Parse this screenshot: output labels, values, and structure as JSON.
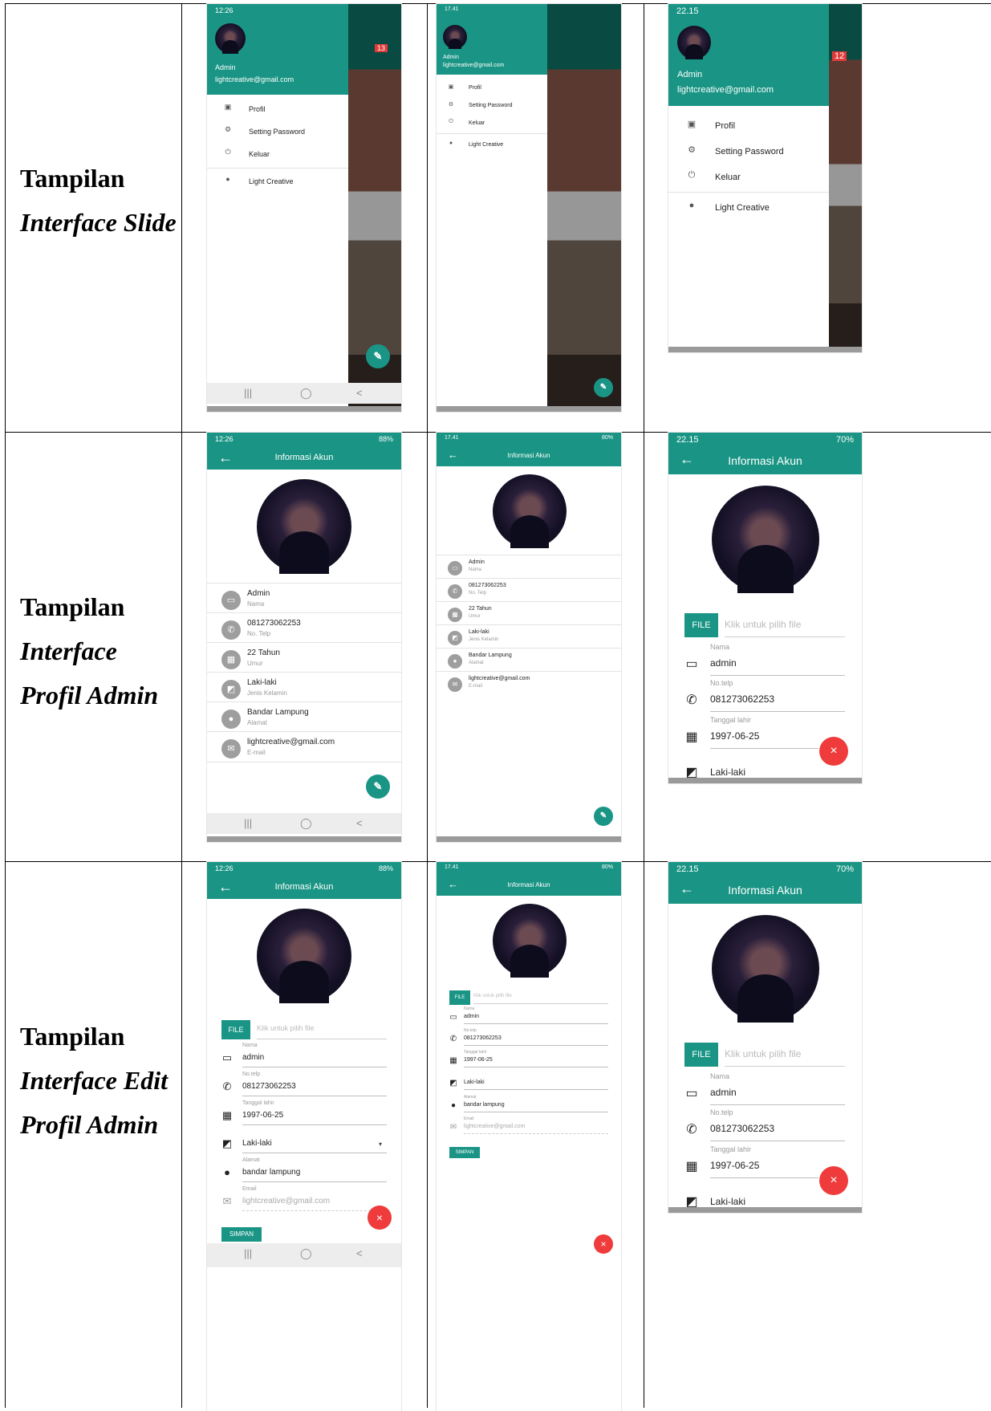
{
  "rows": [
    {
      "label": {
        "line1": "Tampilan",
        "line2": "Interface  Slide",
        "line3": ""
      }
    },
    {
      "label": {
        "line1": "Tampilan",
        "line2": "Interface",
        "line3": "Profil Admin"
      }
    },
    {
      "label": {
        "line1": "Tampilan",
        "line2": "Interface Edit",
        "line3": "Profil Admin"
      }
    }
  ],
  "status": {
    "a": {
      "time": "12:26",
      "right": "88%"
    },
    "b": {
      "time": "17.41",
      "right": "80%"
    },
    "c": {
      "time": "22.15",
      "right": "70%"
    }
  },
  "drawer": {
    "name": "Admin",
    "email": "lightcreative@gmail.com",
    "items": [
      "Profil",
      "Setting Password",
      "Keluar",
      "Light Creative"
    ],
    "badge_a": "13",
    "badge_c": "12"
  },
  "appbar_title": "Informasi Akun",
  "profile": {
    "rows": [
      {
        "value": "Admin",
        "key": "Nama"
      },
      {
        "value": "081273062253",
        "key": "No. Telp"
      },
      {
        "value": "22 Tahun",
        "key": "Umur"
      },
      {
        "value": "Laki-laki",
        "key": "Jenis Kelamin"
      },
      {
        "value": "Bandar Lampung",
        "key": "Alamat"
      },
      {
        "value": "lightcreative@gmail.com",
        "key": "E-mail"
      }
    ]
  },
  "form": {
    "file_btn": "FILE",
    "file_placeholder": "Klik untuk pilih file",
    "nama_label": "Nama",
    "nama": "admin",
    "telp_label": "No.telp",
    "telp": "081273062253",
    "tgl_label": "Tanggal lahir",
    "tgl": "1997-06-25",
    "jk": "Laki-laki",
    "alamat_label": "Alamat",
    "alamat": "bandar lampung",
    "email_label": "Email",
    "email": "lightcreative@gmail.com",
    "save": "SIMPAN"
  }
}
